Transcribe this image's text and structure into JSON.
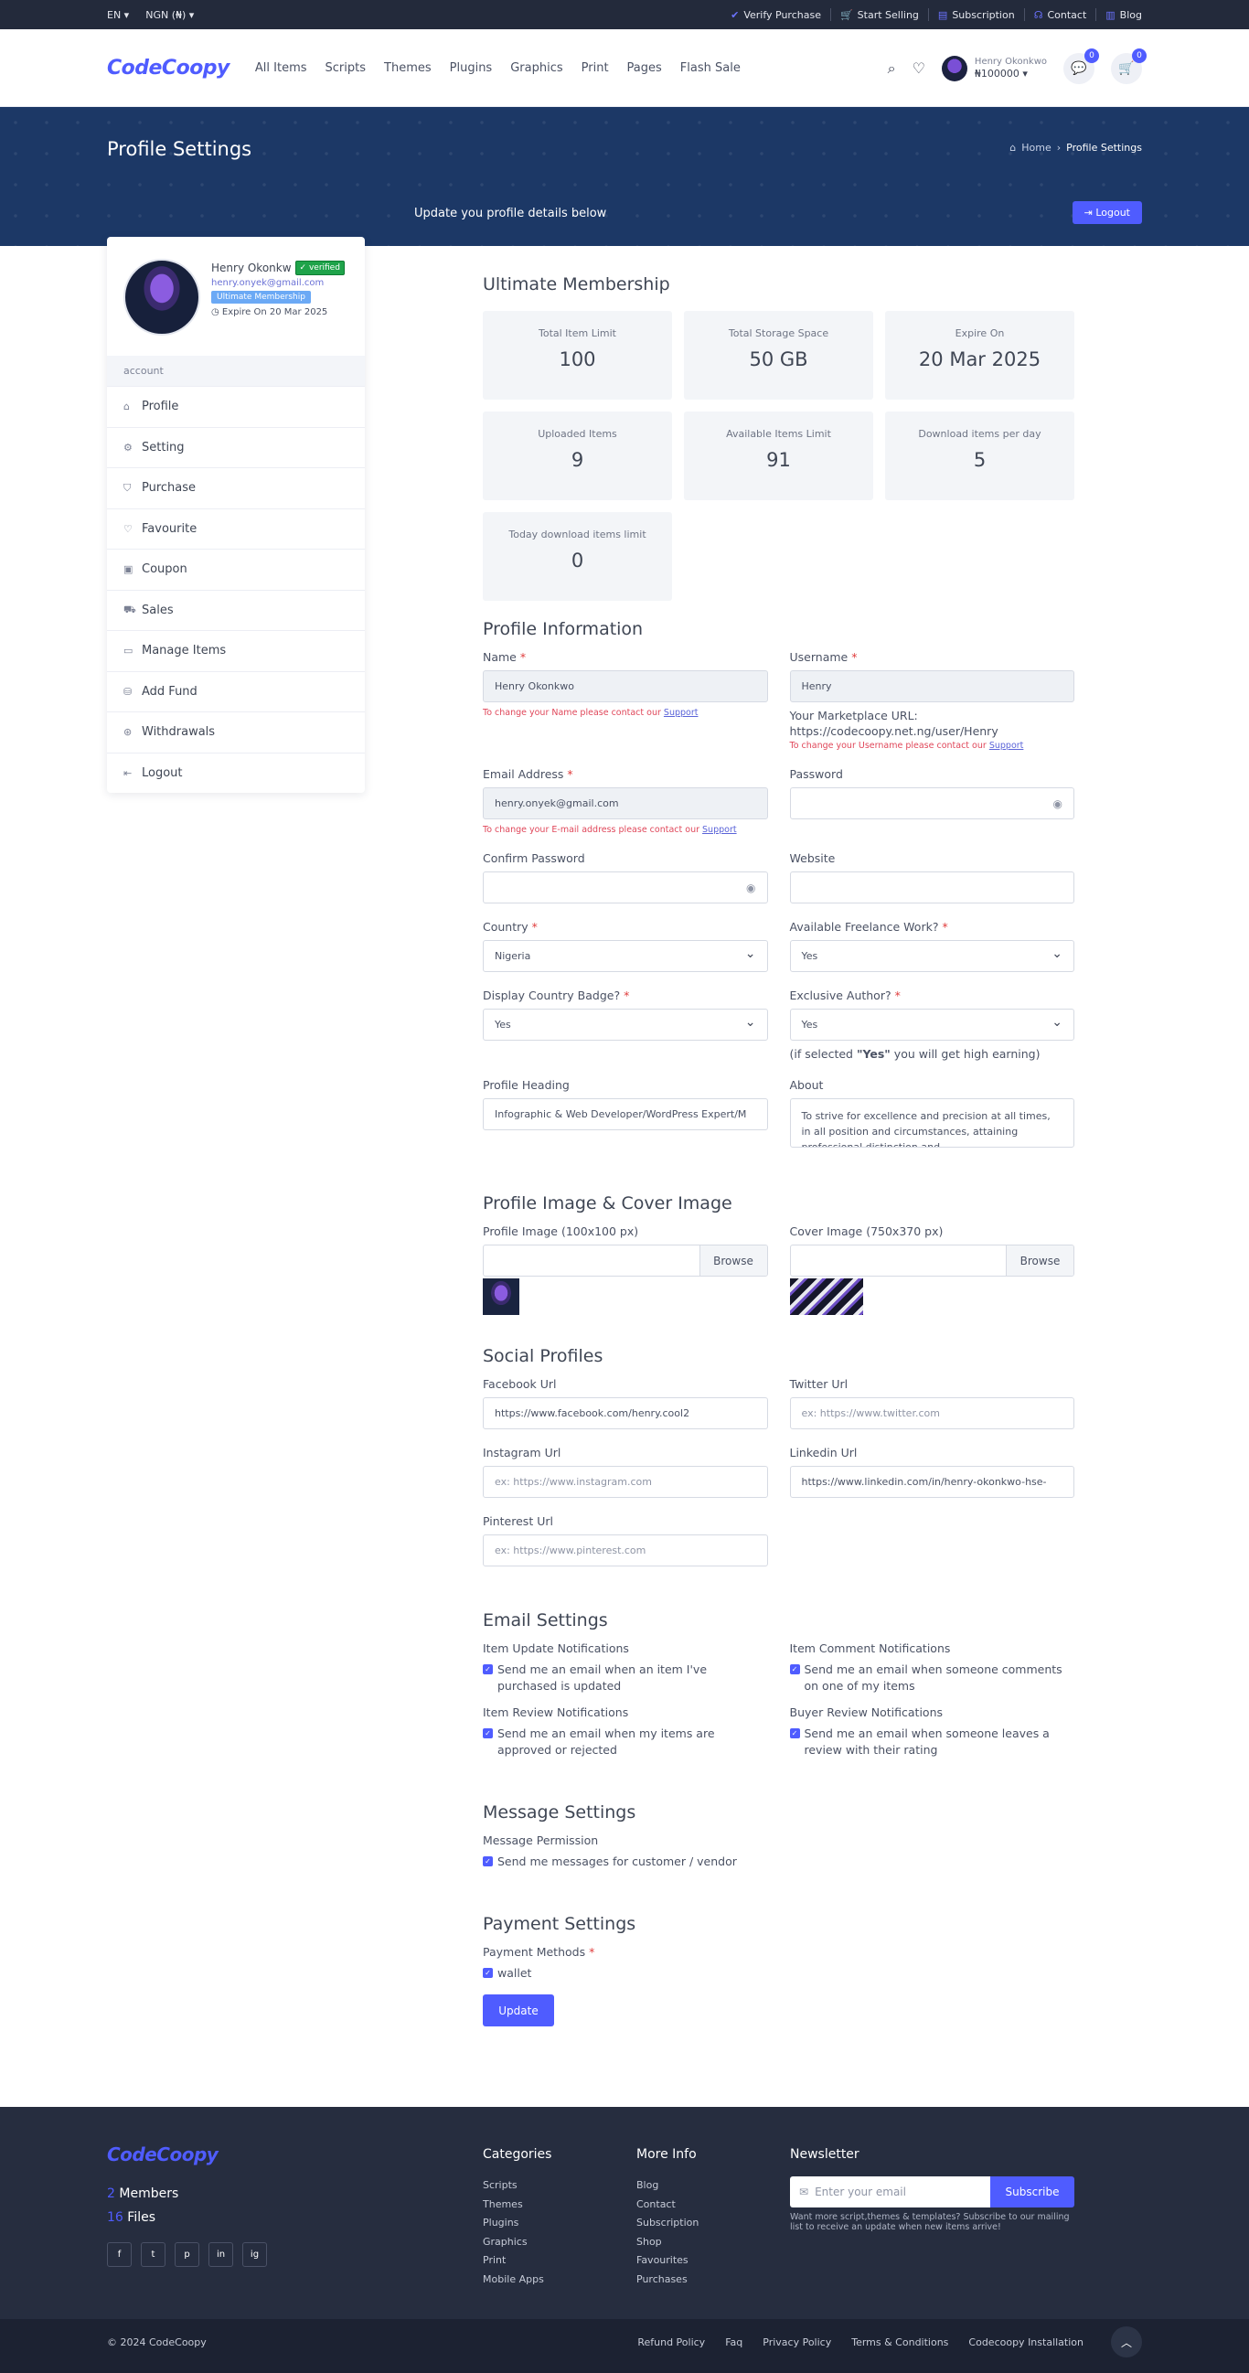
{
  "topbar": {
    "lang": "EN",
    "currency": "NGN (₦)",
    "links": [
      {
        "label": "Verify Purchase",
        "icon": "shield-check-icon"
      },
      {
        "label": "Start Selling",
        "icon": "cart-icon"
      },
      {
        "label": "Subscription",
        "icon": "document-icon"
      },
      {
        "label": "Contact",
        "icon": "headset-icon"
      },
      {
        "label": "Blog",
        "icon": "book-icon"
      }
    ]
  },
  "header": {
    "logo": "CodeCoopy",
    "nav": [
      "All Items",
      "Scripts",
      "Themes",
      "Plugins",
      "Graphics",
      "Print",
      "Pages",
      "Flash Sale"
    ],
    "user_name": "Henry Okonkwo",
    "user_balance": "₦100000",
    "messages_count": "0",
    "cart_count": "0"
  },
  "banner": {
    "title": "Profile Settings",
    "breadcrumb_home": "Home",
    "breadcrumb_current": "Profile Settings",
    "subtitle": "Update you profile details below",
    "logout_label": "Logout"
  },
  "sidebar": {
    "name": "Henry Okonkw",
    "verified_label": "verified",
    "email": "henry.onyek@gmail.com",
    "membership": "Ultimate Membership",
    "expire": "Expire On 20 Mar 2025",
    "section_label": "account",
    "items": [
      {
        "label": "Profile",
        "icon": "home-icon"
      },
      {
        "label": "Setting",
        "icon": "gear-icon"
      },
      {
        "label": "Purchase",
        "icon": "basket-icon"
      },
      {
        "label": "Favourite",
        "icon": "heart-icon"
      },
      {
        "label": "Coupon",
        "icon": "gift-icon"
      },
      {
        "label": "Sales",
        "icon": "cart-icon"
      },
      {
        "label": "Manage Items",
        "icon": "box-icon"
      },
      {
        "label": "Add Fund",
        "icon": "wallet-icon"
      },
      {
        "label": "Withdrawals",
        "icon": "coins-icon"
      },
      {
        "label": "Logout",
        "icon": "logout-icon"
      }
    ]
  },
  "membership": {
    "heading": "Ultimate Membership",
    "stats": [
      {
        "label": "Total Item Limit",
        "value": "100"
      },
      {
        "label": "Total Storage Space",
        "value": "50 GB"
      },
      {
        "label": "Expire On",
        "value": "20 Mar 2025"
      },
      {
        "label": "Uploaded Items",
        "value": "9"
      },
      {
        "label": "Available Items Limit",
        "value": "91"
      },
      {
        "label": "Download items per day",
        "value": "5"
      },
      {
        "label": "Today download items limit",
        "value": "0"
      }
    ]
  },
  "profile": {
    "heading": "Profile Information",
    "name_label": "Name",
    "name_value": "Henry Okonkwo",
    "name_note": "To change your Name please contact our",
    "support": "Support",
    "username_label": "Username",
    "username_value": "Henry",
    "marketplace_label": "Your Marketplace URL:",
    "marketplace_url": "https://codecoopy.net.ng/user/Henry",
    "username_note": "To change your Username please contact our",
    "email_label": "Email Address",
    "email_value": "henry.onyek@gmail.com",
    "email_note": "To change your E-mail address please contact our",
    "password_label": "Password",
    "confirm_label": "Confirm Password",
    "website_label": "Website",
    "country_label": "Country",
    "country_value": "Nigeria",
    "freelance_label": "Available Freelance Work?",
    "freelance_value": "Yes",
    "badge_label": "Display Country Badge?",
    "badge_value": "Yes",
    "exclusive_label": "Exclusive Author?",
    "exclusive_value": "Yes",
    "exclusive_note_pre": "(if selected ",
    "exclusive_note_bold": "\"Yes\"",
    "exclusive_note_post": " you will get high earning)",
    "heading_label": "Profile Heading",
    "heading_value": "Infographic & Web Developer/WordPress Expert/M",
    "about_label": "About",
    "about_value": "To strive for excellence and precision at all times, in all position and circumstances, attaining professional distinction and"
  },
  "images": {
    "heading": "Profile Image & Cover Image",
    "profile_label": "Profile Image (100x100 px)",
    "cover_label": "Cover Image (750x370 px)",
    "browse": "Browse"
  },
  "social": {
    "heading": "Social Profiles",
    "facebook_label": "Facebook Url",
    "facebook_value": "https://www.facebook.com/henry.cool2",
    "twitter_label": "Twitter Url",
    "twitter_placeholder": "ex: https://www.twitter.com",
    "instagram_label": "Instagram Url",
    "instagram_placeholder": "ex: https://www.instagram.com",
    "linkedin_label": "Linkedin Url",
    "linkedin_value": "https://www.linkedin.com/in/henry-okonkwo-hse-",
    "pinterest_label": "Pinterest Url",
    "pinterest_placeholder": "ex: https://www.pinterest.com"
  },
  "email_settings": {
    "heading": "Email Settings",
    "item_update_label": "Item Update Notifications",
    "item_update_text": "Send me an email when an item I've purchased is updated",
    "item_comment_label": "Item Comment Notifications",
    "item_comment_text": "Send me an email when someone comments on one of my items",
    "item_review_label": "Item Review Notifications",
    "item_review_text": "Send me an email when my items are approved or rejected",
    "buyer_review_label": "Buyer Review Notifications",
    "buyer_review_text": "Send me an email when someone leaves a review with their rating"
  },
  "message_settings": {
    "heading": "Message Settings",
    "permission_label": "Message Permission",
    "permission_text": "Send me messages for customer / vendor"
  },
  "payment_settings": {
    "heading": "Payment Settings",
    "methods_label": "Payment Methods",
    "wallet": "wallet",
    "update_label": "Update"
  },
  "footer": {
    "logo": "CodeCoopy",
    "members_count": "2",
    "members_label": "Members",
    "files_count": "16",
    "files_label": "Files",
    "socials": [
      "f",
      "t",
      "p",
      "in",
      "ig"
    ],
    "categories_heading": "Categories",
    "categories": [
      "Scripts",
      "Themes",
      "Plugins",
      "Graphics",
      "Print",
      "Mobile Apps"
    ],
    "moreinfo_heading": "More Info",
    "moreinfo": [
      "Blog",
      "Contact",
      "Subscription",
      "Shop",
      "Favourites",
      "Purchases"
    ],
    "newsletter_heading": "Newsletter",
    "newsletter_placeholder": "Enter your email",
    "subscribe_label": "Subscribe",
    "newsletter_note": "Want more script,themes & templates? Subscribe to our mailing list to receive an update when new items arrive!"
  },
  "bottom": {
    "copyright": "© 2024 CodeCoopy",
    "links": [
      "Refund Policy",
      "Faq",
      "Privacy Policy",
      "Terms & Conditions",
      "Codecoopy Installation"
    ]
  },
  "colors": {
    "accent": "#4f5cff",
    "banner": "#1c3866",
    "footer": "#262d3f",
    "topbar": "#232a3b"
  }
}
